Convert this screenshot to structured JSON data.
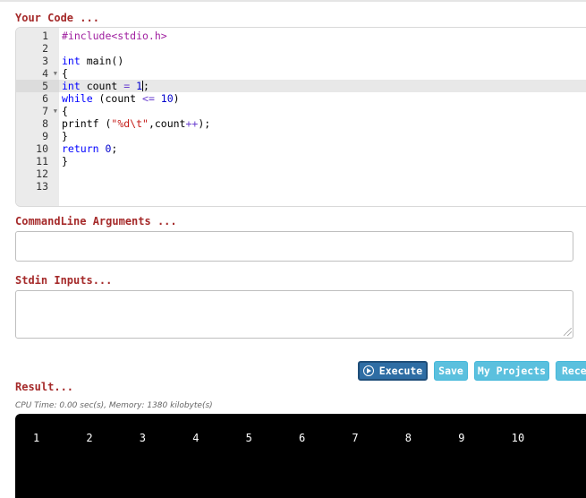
{
  "labels": {
    "code": "Your Code ...",
    "args": "CommandLine Arguments ...",
    "stdin": "Stdin Inputs...",
    "result": "Result..."
  },
  "editor": {
    "line_numbers": [
      "1",
      "2",
      "3",
      "4",
      "5",
      "6",
      "7",
      "8",
      "9",
      "10",
      "11",
      "12",
      "13"
    ],
    "active_line": "5",
    "lines": [
      [
        {
          "t": "#include<stdio.h>",
          "c": "pp"
        }
      ],
      [],
      [
        {
          "t": "int",
          "c": "kw"
        },
        {
          "t": " main()",
          "c": "def"
        }
      ],
      [
        {
          "t": "{",
          "c": "def"
        }
      ],
      [
        {
          "t": "int",
          "c": "kw"
        },
        {
          "t": " count ",
          "c": "def"
        },
        {
          "t": "=",
          "c": "op"
        },
        {
          "t": " 1",
          "c": "num"
        },
        {
          "t": ";",
          "c": "def"
        }
      ],
      [
        {
          "t": "while",
          "c": "kw"
        },
        {
          "t": " (count ",
          "c": "def"
        },
        {
          "t": "<=",
          "c": "op"
        },
        {
          "t": " 10",
          "c": "num"
        },
        {
          "t": ")",
          "c": "def"
        }
      ],
      [
        {
          "t": "{",
          "c": "def"
        }
      ],
      [
        {
          "t": "printf (",
          "c": "def"
        },
        {
          "t": "\"%d\\t\"",
          "c": "str"
        },
        {
          "t": ",count",
          "c": "def"
        },
        {
          "t": "++",
          "c": "op"
        },
        {
          "t": ");",
          "c": "def"
        }
      ],
      [
        {
          "t": "}",
          "c": "def"
        }
      ],
      [
        {
          "t": "return",
          "c": "kw"
        },
        {
          "t": " 0",
          "c": "num"
        },
        {
          "t": ";",
          "c": "def"
        }
      ],
      [
        {
          "t": "}",
          "c": "def"
        }
      ],
      [],
      []
    ]
  },
  "inputs": {
    "args_value": "",
    "stdin_value": ""
  },
  "buttons": {
    "execute": "Execute",
    "save": "Save",
    "projects": "My Projects",
    "recent": "Recent"
  },
  "result": {
    "stats": "CPU Time: 0.00 sec(s), Memory: 1380 kilobyte(s)",
    "output": "1\t2\t3\t4\t5\t6\t7\t8\t9\t10"
  }
}
